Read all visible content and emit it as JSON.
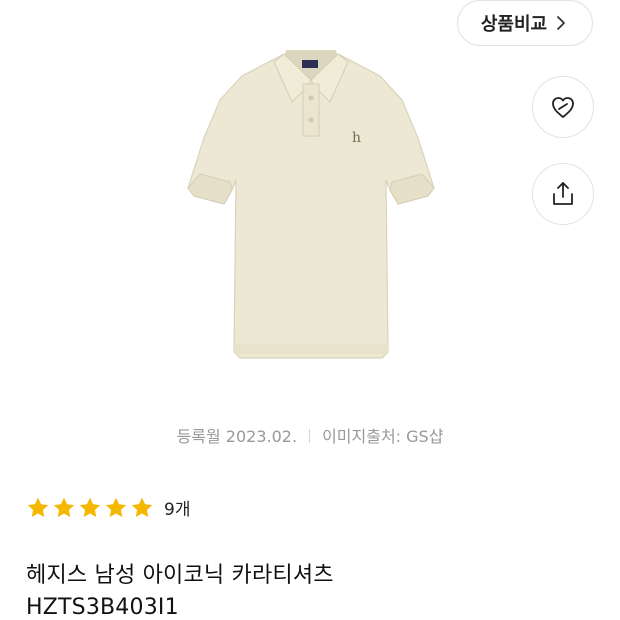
{
  "compare": {
    "label": "상품비교"
  },
  "meta": {
    "registered": "등록월 2023.02.",
    "image_source": "이미지출처: GS샵"
  },
  "rating": {
    "stars": 5,
    "count": "9개",
    "star_color": "#F5B800"
  },
  "product": {
    "title_line1": "헤지스 남성 아이코닉 카라티셔츠",
    "title_line2": "HZTS3B403I1",
    "shirt_color": "#EDE8D3"
  },
  "icons": {
    "compare": "chevron-right-icon",
    "wishlist": "heart-link-icon",
    "share": "share-upload-icon",
    "star": "star-icon"
  }
}
